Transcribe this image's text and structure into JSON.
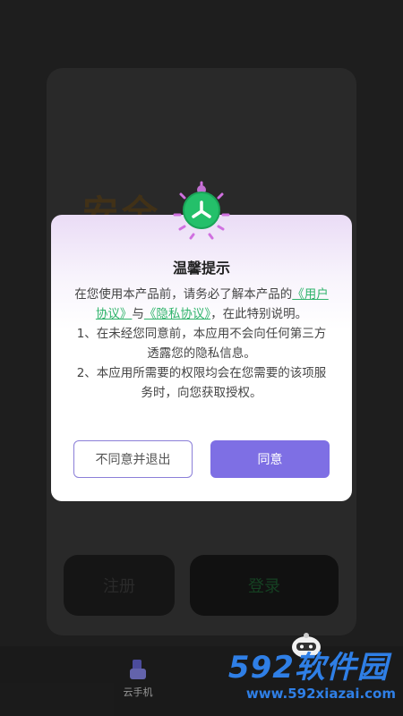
{
  "background": {
    "banner_text": "安全",
    "register_label": "注册",
    "login_label": "登录",
    "nav": {
      "cloud_phone_label": "云手机"
    }
  },
  "watermark": {
    "brand": "592软件园",
    "url": "www.592xiazai.com"
  },
  "dialog": {
    "title": "温馨提示",
    "intro_prefix": "在您使用本产品前，请务必了解本产品的",
    "user_agreement_link": "《用户协议》",
    "and_text": "与",
    "privacy_link": "《隐私协议》",
    "intro_suffix": "，在此特别说明。",
    "item1": "1、在未经您同意前，本应用不会向任何第三方透露您的隐私信息。",
    "item2": "2、本应用所需要的权限均会在您需要的该项服务时，向您获取授权。",
    "decline_label": "不同意并退出",
    "agree_label": "同意"
  },
  "colors": {
    "accent": "#7e6fe4",
    "link": "#2fb36b",
    "watermark": "#2f7fe6"
  }
}
